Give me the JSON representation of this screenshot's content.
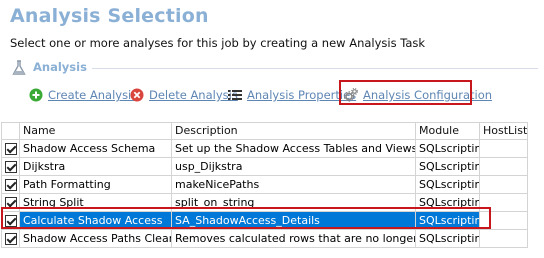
{
  "header": {
    "title": "Analysis Selection",
    "subtitle": "Select one or more analyses for this job by creating a new Analysis Task"
  },
  "section": {
    "label": "Analysis",
    "icon": "flask-icon"
  },
  "toolbar": {
    "create": {
      "label": "Create Analysis",
      "icon": "plus-circle-icon",
      "color": "#3aa935"
    },
    "delete": {
      "label": "Delete Analysis",
      "icon": "delete-x-icon",
      "color": "#d9453d"
    },
    "properties": {
      "label": "Analysis Properties",
      "icon": "list-icon"
    },
    "configuration": {
      "label": "Analysis Configuration",
      "icon": "gears-icon",
      "highlighted": true
    }
  },
  "table": {
    "columns": [
      "",
      "Name",
      "Description",
      "Module",
      "HostLists"
    ],
    "rows": [
      {
        "checked": true,
        "name": "Shadow Access Schema",
        "description": "Set up the Shadow Access Tables and Views",
        "module": "SQLscripting",
        "hostlists": "",
        "selected": false
      },
      {
        "checked": true,
        "name": "Dijkstra",
        "description": "usp_Dijkstra",
        "module": "SQLscripting",
        "hostlists": "",
        "selected": false
      },
      {
        "checked": true,
        "name": "Path Formatting",
        "description": "makeNicePaths",
        "module": "SQLscripting",
        "hostlists": "",
        "selected": false
      },
      {
        "checked": true,
        "name": "String Split",
        "description": "split_on_string",
        "module": "SQLscripting",
        "hostlists": "",
        "selected": false
      },
      {
        "checked": true,
        "name": "Calculate Shadow Access",
        "description": "SA_ShadowAccess_Details",
        "module": "SQLscripting",
        "hostlists": "",
        "selected": true
      },
      {
        "checked": true,
        "name": "Shadow Access Paths Cleanup",
        "description": "Removes calculated rows that are no longer used",
        "module": "SQLscripting",
        "hostlists": "",
        "selected": false
      }
    ]
  },
  "colors": {
    "accent": "#8ab0d6",
    "link": "#5e86b4",
    "selection": "#0078d7",
    "highlight": "#c8161d"
  }
}
